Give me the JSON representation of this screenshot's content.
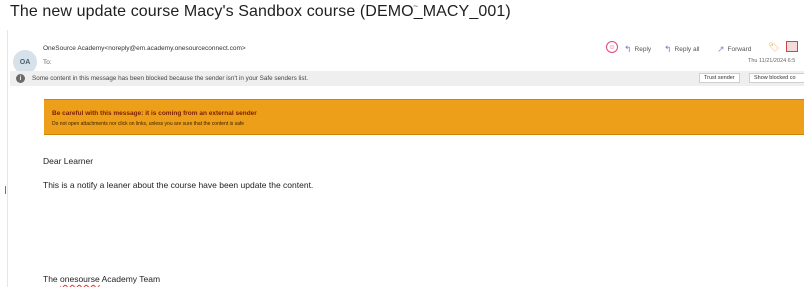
{
  "subject": "The new update course Macy's Sandbox course (DEMO_MACY_001)",
  "stray_mark": "~",
  "sender": {
    "initials": "OA",
    "display": "OneSource Academy<noreply@em.academy.onesourceconnect.com>",
    "to_label": "To:",
    "timestamp": "Thu 11/21/2024 6:5"
  },
  "actions": {
    "reply": "Reply",
    "reply_all": "Reply all",
    "forward": "Forward"
  },
  "icons": {
    "emoji": "☺",
    "reply": "↰",
    "reply_all": "↰",
    "forward": "↗",
    "sticker": "🏷",
    "info": "i"
  },
  "blocked_bar": {
    "text": "Some content in this message has been blocked because the sender isn't in your Safe senders list.",
    "trust_sender": "Trust sender",
    "show_blocked": "Show blocked co"
  },
  "warning": {
    "title": "Be careful with this message: it is coming from an external sender",
    "detail": "Do not open attachments nor click on links, unless you are sure that the content is safe"
  },
  "body": {
    "greeting": "Dear Learner",
    "message": "This is a notify a leaner about the course have been update the content.",
    "signature_prefix": "The ",
    "signature_misspelled": "onesourse",
    "signature_suffix": " Academy Team"
  },
  "colors": {
    "warning_bg": "#ee9f1a",
    "warning_title": "#7a1f00",
    "action_arrow": "#7b7bd0",
    "emoji_accent": "#e0467a"
  }
}
